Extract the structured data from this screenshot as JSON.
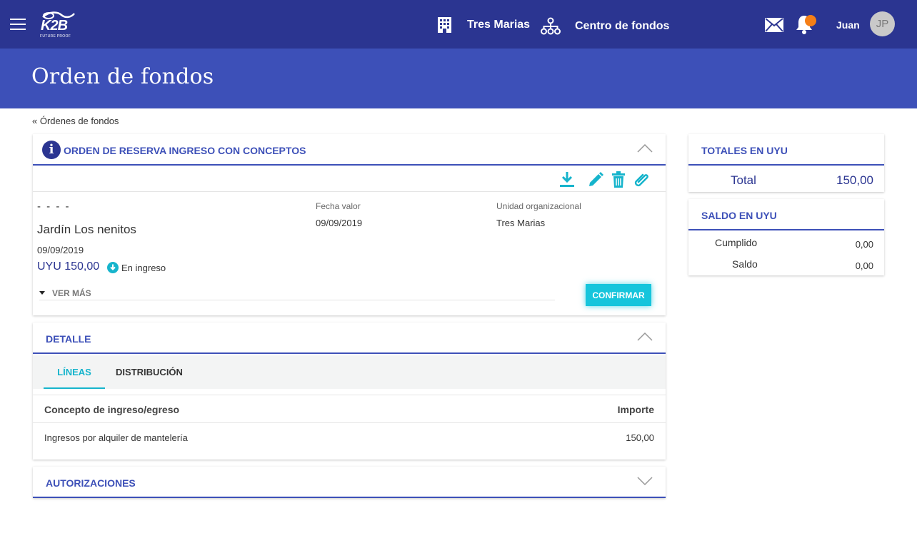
{
  "header": {
    "logo_text": "K2B",
    "logo_tagline": "FUTURE PROOF",
    "company": "Tres Marias",
    "cost_center": "Centro de fondos",
    "user_name": "Juan",
    "user_initials": "JP"
  },
  "page": {
    "title": "Orden de fondos",
    "breadcrumb": "« Órdenes de fondos"
  },
  "order_card": {
    "title": "ORDEN DE RESERVA INGRESO CON CONCEPTOS",
    "number": "- - - -",
    "client": "Jardín Los nenitos",
    "date": "09/09/2019",
    "amount": "UYU 150,00",
    "status": "En ingreso",
    "fecha_valor_label": "Fecha valor",
    "fecha_valor": "09/09/2019",
    "unidad_label": "Unidad organizacional",
    "unidad": "Tres Marias",
    "ver_mas": "VER MÁS",
    "confirm_button": "CONFIRMAR",
    "tools": [
      "download-icon",
      "edit-icon",
      "delete-icon",
      "attach-icon"
    ]
  },
  "detalle": {
    "title": "DETALLE",
    "tabs": [
      {
        "label": "LÍNEAS",
        "active": true
      },
      {
        "label": "DISTRIBUCIÓN",
        "active": false
      }
    ],
    "columns": [
      "Concepto de ingreso/egreso",
      "Importe"
    ],
    "rows": [
      {
        "concepto": "Ingresos por alquiler de mantelería",
        "importe": "150,00"
      }
    ]
  },
  "autorizaciones": {
    "title": "AUTORIZACIONES"
  },
  "totales": {
    "title": "TOTALES EN UYU",
    "total_label": "Total",
    "total_value": "150,00"
  },
  "saldo": {
    "title": "SALDO EN UYU",
    "cumplido_label": "Cumplido",
    "cumplido_value": "0,00",
    "saldo_label": "Saldo",
    "saldo_value": "0,00"
  },
  "colors": {
    "topbar": "#2b3591",
    "title_band": "#3d50b8",
    "accent": "#16c5dc",
    "notification": "#f57f17"
  }
}
